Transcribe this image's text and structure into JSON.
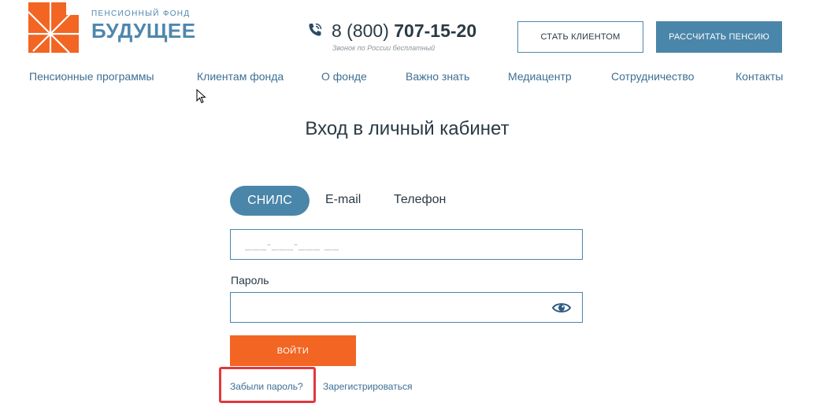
{
  "brand": {
    "subtitle": "ПЕНСИОННЫЙ ФОНД",
    "name": "БУДУЩЕЕ"
  },
  "phone": {
    "prefix": "8 (800)",
    "number": "707-15-20",
    "note": "Звонок по России бесплатный"
  },
  "header_buttons": {
    "become_client": "СТАТЬ КЛИЕНТОМ",
    "calculate_pension": "РАССЧИТАТЬ ПЕНСИЮ"
  },
  "nav": {
    "items": [
      "Пенсионные программы",
      "Клиентам фонда",
      "О фонде",
      "Важно знать",
      "Медиацентр",
      "Сотрудничество",
      "Контакты"
    ]
  },
  "login": {
    "title": "Вход в личный кабинет",
    "tabs": [
      "СНИЛС",
      "E-mail",
      "Телефон"
    ],
    "active_tab": "СНИЛС",
    "snils_placeholder": "___-___-___ __",
    "password_label": "Пароль",
    "password_value": "",
    "submit_label": "ВОЙТИ",
    "forgot_label": "Забыли пароль?",
    "register_label": "Зарегистрироваться"
  },
  "colors": {
    "accent_orange": "#f26522",
    "accent_blue": "#4a86a9",
    "highlight_red": "#e0383e"
  }
}
